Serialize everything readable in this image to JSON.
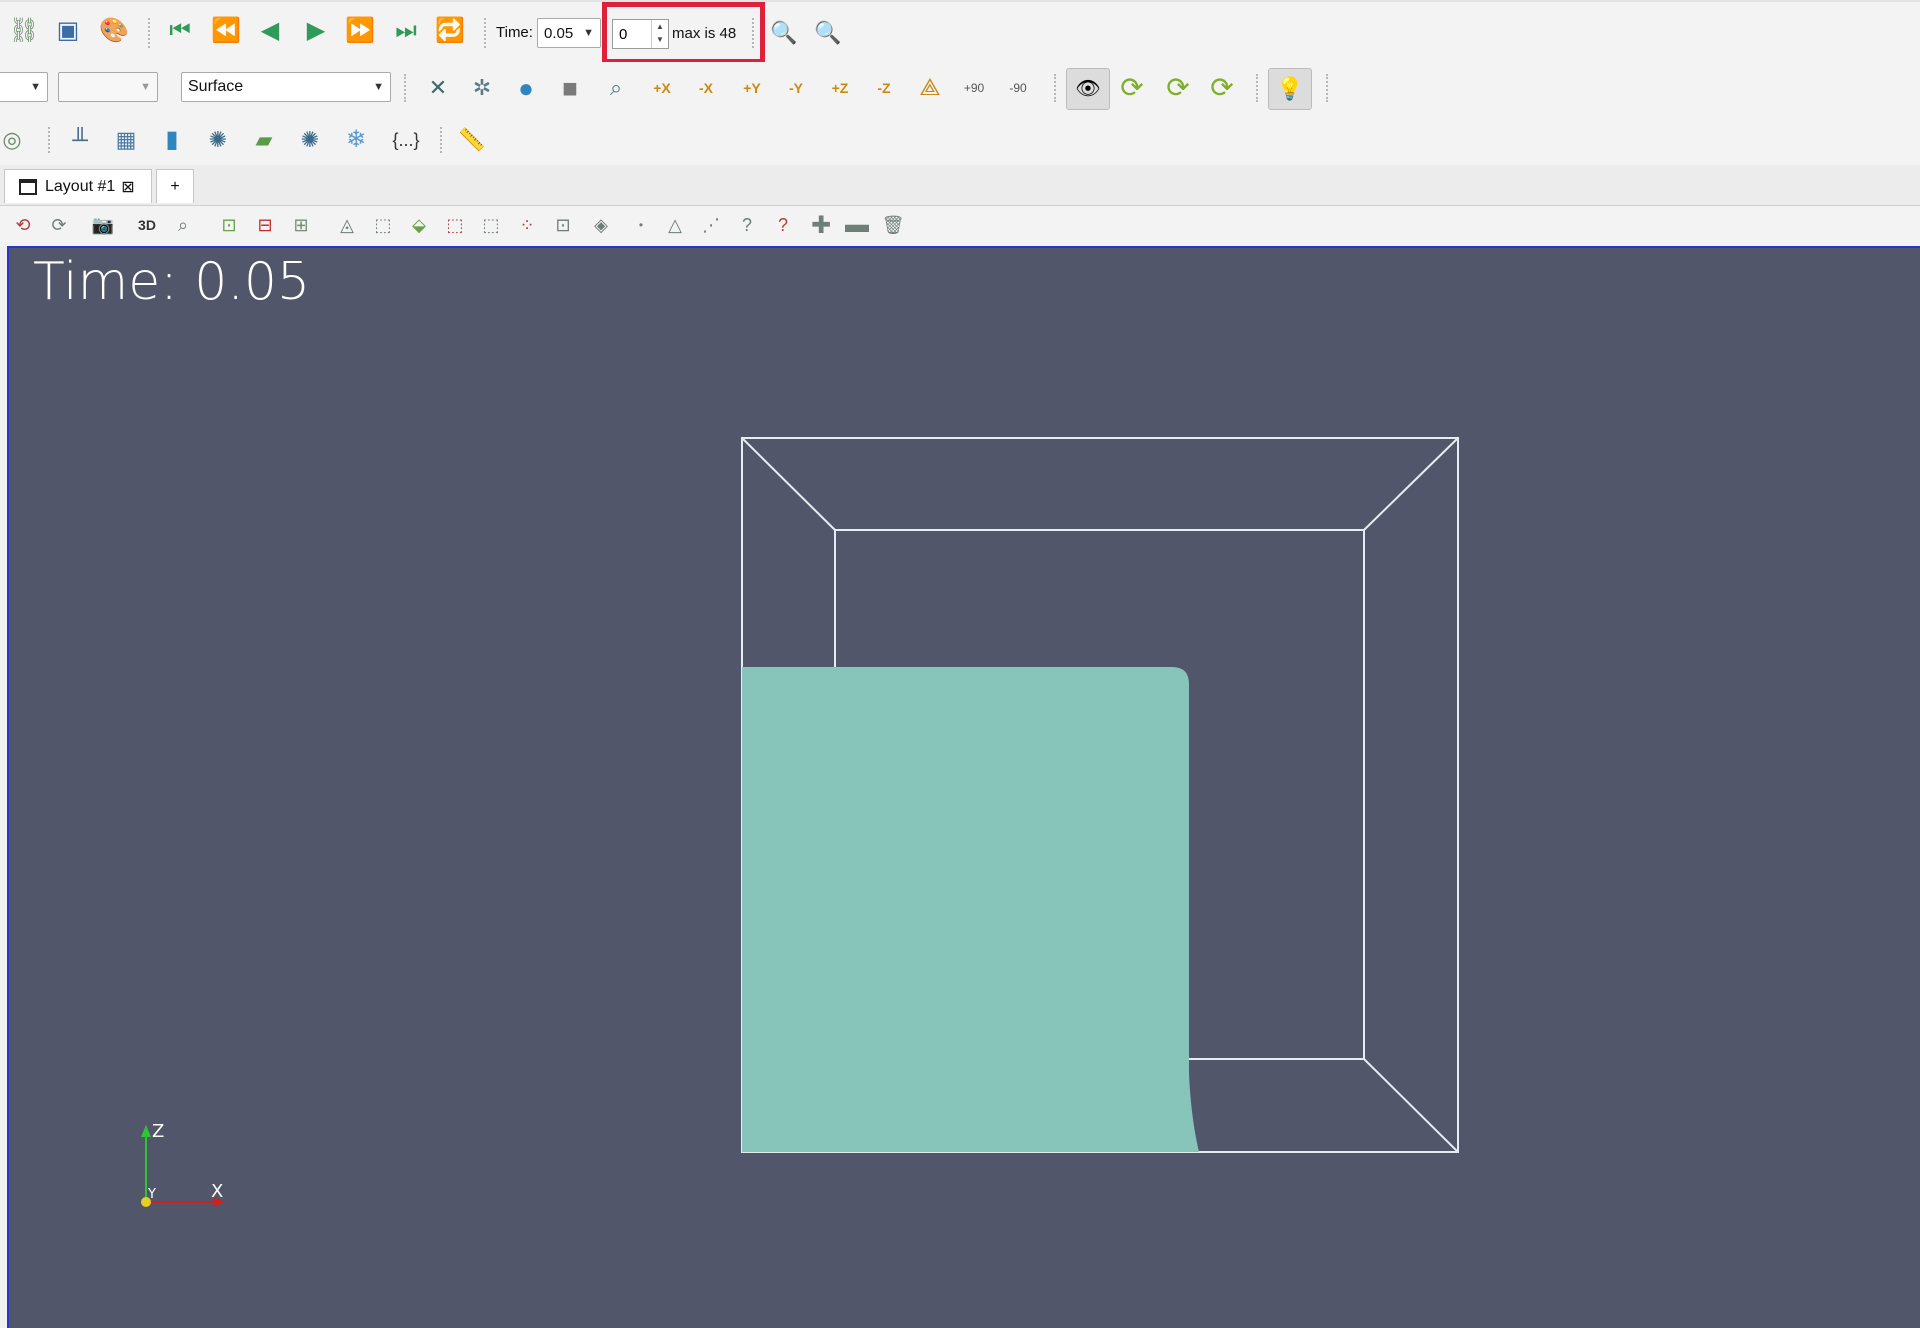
{
  "toolbar_main": {
    "buttons": [
      {
        "name": "connect-icon",
        "glyph": "⛓"
      },
      {
        "name": "disconnect-icon",
        "glyph": "▣"
      },
      {
        "name": "palette-icon",
        "glyph": "🎨"
      },
      {
        "name": "first-frame-icon",
        "glyph": "⏮"
      },
      {
        "name": "previous-frame-icon",
        "glyph": "⏪"
      },
      {
        "name": "play-backward-icon",
        "glyph": "◀"
      },
      {
        "name": "play-icon",
        "glyph": "▶"
      },
      {
        "name": "next-frame-icon",
        "glyph": "⏩"
      },
      {
        "name": "last-frame-icon",
        "glyph": "⏭"
      },
      {
        "name": "loop-icon",
        "glyph": "🔁"
      }
    ],
    "time_label": "Time:",
    "time_value": "0.05",
    "timestep_value": "0",
    "max_label": "max is 48",
    "zoom_icon": "🔍",
    "zoom_add_icon": "🔍"
  },
  "toolbar_display": {
    "combo1_value": "",
    "combo2_value": "",
    "representation": "Surface",
    "camera_buttons": [
      {
        "name": "reset-camera-icon",
        "label": "✕"
      },
      {
        "name": "zoom-to-data-icon",
        "label": "✲"
      },
      {
        "name": "zoom-closest-icon",
        "label": "●"
      },
      {
        "name": "zoom-to-box-icon",
        "label": "■"
      },
      {
        "name": "zoom-to-selection-icon",
        "label": "⌕"
      },
      {
        "name": "set-view-plus-x-icon",
        "label": "+X"
      },
      {
        "name": "set-view-minus-x-icon",
        "label": "-X"
      },
      {
        "name": "set-view-plus-y-icon",
        "label": "+Y"
      },
      {
        "name": "set-view-minus-y-icon",
        "label": "-Y"
      },
      {
        "name": "set-view-plus-z-icon",
        "label": "+Z"
      },
      {
        "name": "set-view-minus-z-icon",
        "label": "-Z"
      },
      {
        "name": "isometric-view-icon",
        "label": "⟁"
      },
      {
        "name": "rotate-plus-90-icon",
        "label": "+90"
      },
      {
        "name": "rotate-minus-90-icon",
        "label": "-90"
      }
    ],
    "interaction_buttons": [
      {
        "name": "interaction-mode-icon",
        "label": "👁"
      },
      {
        "name": "rotate-icon",
        "label": "⟳"
      },
      {
        "name": "pick-center-icon",
        "label": "⟳"
      },
      {
        "name": "reset-center-icon",
        "label": "⟳"
      },
      {
        "name": "light-kit-icon",
        "label": "💡"
      }
    ]
  },
  "toolbar_filters": {
    "buttons": [
      {
        "name": "calculator-icon",
        "label": "◎"
      },
      {
        "name": "plot-over-line-icon",
        "label": "╨"
      },
      {
        "name": "extract-selection-icon",
        "label": "▦"
      },
      {
        "name": "histogram-icon",
        "label": "▮"
      },
      {
        "name": "glyph-icon",
        "label": "✺"
      },
      {
        "name": "python-calculator-icon",
        "label": "▰"
      },
      {
        "name": "probe-icon",
        "label": "✺"
      },
      {
        "name": "snowflake-icon",
        "label": "❄"
      },
      {
        "name": "braces-icon",
        "label": "{...}"
      },
      {
        "name": "ruler-icon",
        "label": "📏"
      }
    ]
  },
  "tabs": {
    "layout_label": "Layout #1",
    "close_glyph": "⊠",
    "add_glyph": "+"
  },
  "view_toolbar": {
    "mode_label": "3D"
  },
  "viewport": {
    "time_text": "Time: 0.05",
    "axis_z": "Z",
    "axis_y": "Y",
    "axis_x": "X",
    "background_color": "#52566a",
    "fluid_color": "#87c4ba"
  }
}
